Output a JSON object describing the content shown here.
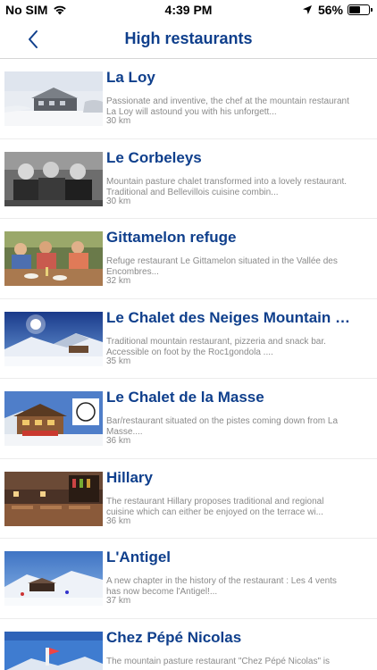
{
  "status_bar": {
    "carrier": "No SIM",
    "time": "4:39 PM",
    "battery": "56%",
    "battery_level": 0.56
  },
  "nav": {
    "title": "High restaurants",
    "back_icon": "chevron-left-icon"
  },
  "colors": {
    "title_blue": "#0f3f8c",
    "muted_text": "#8a8a8a"
  },
  "restaurants": [
    {
      "name": "La Loy",
      "description": "Passionate and inventive, the chef at the mountain restaurant La Loy will astound you with his unforgett...",
      "distance": "30 km"
    },
    {
      "name": "Le Corbeleys",
      "description": "Mountain pasture chalet transformed into a lovely restaurant. Traditional and Bellevillois cuisine combin...",
      "distance": "30 km"
    },
    {
      "name": "Gittamelon  refuge",
      "description": "Refuge  restaurant Le Gittamelon situated in the Vallée des Encombres...",
      "distance": "32 km"
    },
    {
      "name": "Le Chalet des Neiges Mountain re...",
      "description": "Traditional mountain restaurant, pizzeria and snack bar. Accessible on foot by the Roc1gondola ....",
      "distance": "35 km"
    },
    {
      "name": "Le Chalet de la Masse",
      "description": "Bar/restaurant situated on the pistes coming down from La Masse....",
      "distance": "36 km"
    },
    {
      "name": "Hillary",
      "description": "The restaurant Hillary proposes traditional and regional cuisine which can either be enjoyed on the terrace wi...",
      "distance": "36 km"
    },
    {
      "name": "L'Antigel",
      "description": "A new chapter in the history of the restaurant : Les 4 vents has now become  l'Antigel!...",
      "distance": "37 km"
    },
    {
      "name": "Chez Pépé Nicolas",
      "description": "The mountain pasture restaurant \"Chez Pépé Nicolas\" is",
      "distance": ""
    }
  ]
}
